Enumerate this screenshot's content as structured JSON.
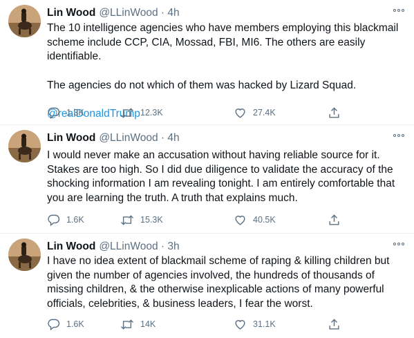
{
  "tweets": [
    {
      "name": "Lin Wood",
      "handle": "@LLinWood",
      "time": "4h",
      "paragraphs": [
        "The 10 intelligence agencies who have members employing this blackmail scheme include CCP, CIA, Mossad, FBI, MI6. The others are easily identifiable.",
        "The agencies do not which of them was hacked by Lizard Squad."
      ],
      "mention": "@realDonaldTrump",
      "replies": "1.3K",
      "retweets": "12.3K",
      "likes": "27.4K"
    },
    {
      "name": "Lin Wood",
      "handle": "@LLinWood",
      "time": "4h",
      "paragraphs": [
        "I would never make an accusation without having reliable source for it. Stakes are too high. So I did due diligence to validate the accuracy of the shocking information I am revealing tonight. I am entirely comfortable that you are learning the truth. A truth that explains much."
      ],
      "replies": "1.6K",
      "retweets": "15.3K",
      "likes": "40.5K"
    },
    {
      "name": "Lin Wood",
      "handle": "@LLinWood",
      "time": "3h",
      "paragraphs": [
        "I have no idea extent of blackmail scheme of raping & killing children but given the number of agencies involved, the hundreds of thousands of missing children, & the otherwise inexplicable actions of many powerful officials, celebrities, & business leaders, I fear the worst."
      ],
      "replies": "1.6K",
      "retweets": "14K",
      "likes": "31.1K"
    }
  ],
  "separator": "·",
  "icons": [
    "avatar",
    "more-icon",
    "reply-icon",
    "retweet-icon",
    "like-icon",
    "share-icon"
  ],
  "colors": {
    "text": "#0f1419",
    "muted": "#5b7083",
    "link": "#1b95e0",
    "divider": "#e6ecf0"
  }
}
